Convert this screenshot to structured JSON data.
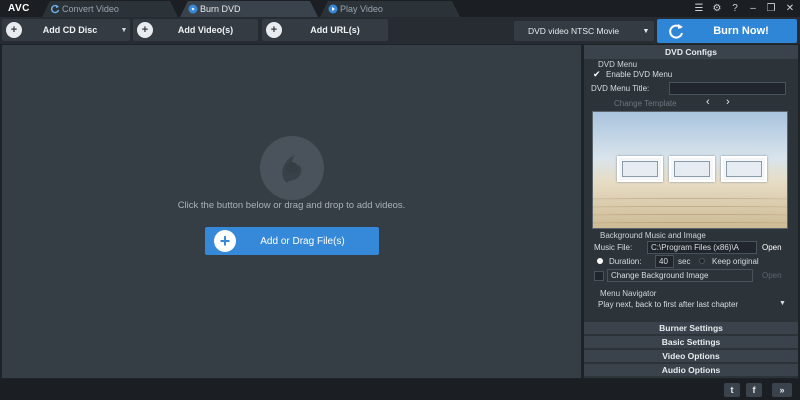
{
  "app": {
    "logo": "AVC",
    "tabs": [
      {
        "label": "Convert Video",
        "icon": "refresh-icon"
      },
      {
        "label": "Burn DVD",
        "icon": "disc-icon"
      },
      {
        "label": "Play Video",
        "icon": "play-icon"
      }
    ],
    "window_controls": {
      "menu": "☰",
      "settings": "⚙",
      "help": "?",
      "minimize": "–",
      "restore": "❐",
      "close": "✕"
    }
  },
  "toolbar": {
    "add_cd_disc": "Add CD Disc",
    "add_videos": "Add Video(s)",
    "add_urls": "Add URL(s)",
    "output_profile": "DVD video NTSC Movie",
    "burn_now": "Burn Now!"
  },
  "main": {
    "hint": "Click the button below or drag and drop to add videos.",
    "add_files": "Add or Drag File(s)"
  },
  "dvd_configs": {
    "header": "DVD Configs",
    "dvd_menu_label": "DVD Menu",
    "enable_dvd_menu": "Enable DVD Menu",
    "enable_dvd_menu_checked": true,
    "menu_title_label": "DVD Menu Title:",
    "menu_title_value": "",
    "change_template": "Change Template",
    "bg_music_image_label": "Background Music and Image",
    "music_file_label": "Music File:",
    "music_file_value": "C:\\Program Files (x86)\\A",
    "open": "Open",
    "duration_label": "Duration:",
    "duration_value": "40",
    "sec": "sec",
    "keep_original": "Keep original",
    "change_bg_image": "Change Background Image",
    "open_disabled": "Open",
    "menu_navigator_label": "Menu Navigator",
    "menu_navigator_value": "Play next, back to first after last chapter"
  },
  "sections": {
    "burner_settings": "Burner Settings",
    "basic_settings": "Basic Settings",
    "video_options": "Video Options",
    "audio_options": "Audio Options"
  },
  "statusbar": {
    "twitter": "t",
    "facebook": "f",
    "expand": "»"
  },
  "colors": {
    "accent": "#2f86d6",
    "background": "#363e45",
    "panel": "#2c3339"
  }
}
